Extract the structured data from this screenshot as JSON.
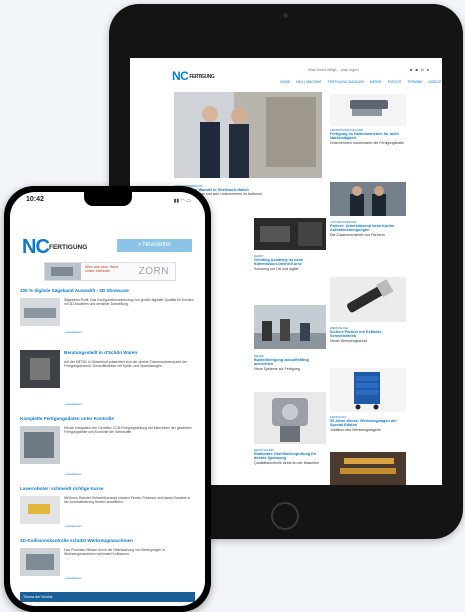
{
  "tablet": {
    "logo": "NC",
    "logo_sub": "FERTIGUNG",
    "search_text": "Was beschäftigt... was lugen",
    "nav": [
      "HOME",
      "NEU | MACHINE",
      "FERTIGUNG MAGAZIN",
      "MESSE",
      "EVENTS",
      "TERMINE",
      "VIDEOS"
    ],
    "tiles": [
      {
        "cat": "FERTIGUNGSPRAXIS",
        "title": "Erfolgreicher Wandel in Strehbach-Hallen",
        "body": "Dr. Andreas Dorner und sein Unternehmen im Aufbruch"
      },
      {
        "cat": "ZERSPANUNGSTECHNIK",
        "title": "Fertigung im Hallenbetrieben für mehr Nachhaltigkeit",
        "body": "Unternehmen modernisiert die Fertigungshalle"
      },
      {
        "cat": "AUTOMATISIERUNG",
        "title": "Partner: Unterstützend beim Karrier Aufnahmebringungen",
        "body": "Die Zusammenarbeit von Partnern"
      },
      {
        "cat": "MARKT",
        "title": "Grinding Academy ist neue Kommission-Online-Kurse",
        "body": "Schulung vor Ort und digital"
      },
      {
        "cat": "WERKZEUGE",
        "title": "Sichere Partner mit Kebluter-Schnellbetrieb",
        "body": "Neuer Werkzeugschutz"
      },
      {
        "cat": "MESSE",
        "title": "Bustellbringung zukunftsfähig ausrichten",
        "body": "Neue Systeme zur Fertigung"
      },
      {
        "cat": "FERTIGUNG",
        "title": "50 Jahre Werks: Werkzeugwagen der Spezial Edition",
        "body": "Jubiläum des Werkzeugwagens"
      },
      {
        "cat": "MESSTECHNIK",
        "title": "Stationäre Oberflächenprüfung für direkte Spannung",
        "body": "Qualitätskontrolle direkt an der Maschine"
      }
    ]
  },
  "phone": {
    "time": "10:42",
    "status_icons": "▮▮ ◠ ▭",
    "logo": "NC",
    "logo_sub": "FERTIGUNG",
    "newsletter_label": "» Newsletter",
    "ad_text_1": "Alles aus einer Hand",
    "ad_text_2": "Unser Maßstab",
    "ad_logo": "ZORN",
    "articles": [
      {
        "title": "100 % digitale Sägeband Auswahlt - 3D Showcase",
        "body": "Sägeband-Profil: Das Konfigurationswerkzeug von großer digitaler Qualität für Kunden mit 3D-Modellen und sensibler Darstellung.",
        "more": "» weiterlesen"
      },
      {
        "title": "Beratungsstellt in d'Schön Waren",
        "body": "Auf der METAV in Düsseldorf präsentiert sich der direkte Themenschwerpunkt der Fertigungstechnik: Geschäftsfelder mit Spritz- und Spanlösungen.",
        "more": "» weiterlesen"
      },
      {
        "title": "Komplette Fertigungsdaten unter Kontrolle",
        "body": "Mit der Integration der Cerbetec CCB-Fertigungsleitung auf Maschinen der gesamten Fertigungskette und Kontrolle der Werkstoffe.",
        "more": "» weiterlesen"
      },
      {
        "title": "Laserroboter: schmeidt richtige Kurse",
        "body": "Mit ihrem Roboter-Schweißkonzept erzielen Firmen Präzision und lassen Bauteile in der Automatisierung flexibel auswählen.",
        "more": "» weiterlesen"
      },
      {
        "title": "3D-Kollisionskontrolle schützt Werkzeugmaschinen",
        "body": "Das Prozesse-Wissen durch die Überwachung von Bewegungen in Werkzeugmaschinen verhindert Kollisionen.",
        "more": "» weiterlesen"
      }
    ],
    "footer": "Thema der Woche"
  },
  "colors": {
    "accent": "#0a7bd0",
    "newsletter": "#8cc4e8",
    "footer": "#1a5f98"
  }
}
